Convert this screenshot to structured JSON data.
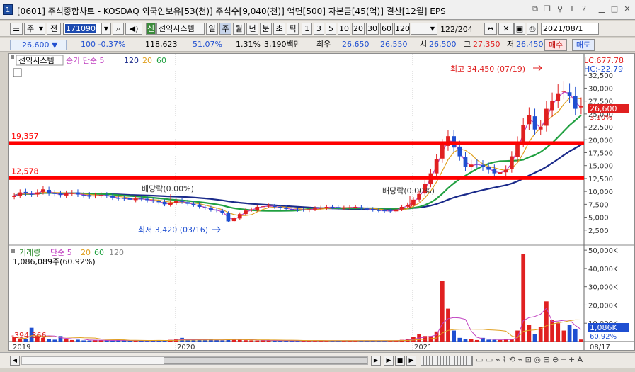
{
  "window": {
    "number": "1",
    "title": "[0601] 주식종합차트 - KOSDAQ 외국인보유[53(천)] 주식수[9,040(천)] 액면[500] 자본금[45(억)] 결산[12월] EPS"
  },
  "toolbar": {
    "period_select": "주",
    "prev_label": "전",
    "stock_code": "171090",
    "indicator_label": "선익시스템",
    "new_badge": "신",
    "periods": [
      "일",
      "주",
      "월",
      "년",
      "분",
      "초",
      "틱"
    ],
    "selected_period": "주",
    "intervals": [
      "1",
      "3",
      "5",
      "10",
      "20",
      "30",
      "60",
      "120"
    ],
    "count_display": "122",
    "count_total": "204",
    "date_value": "2021/08/1"
  },
  "quote": {
    "price": "26,600",
    "change": "100",
    "change_pct": "-0.37%",
    "volume": "118,623",
    "ratio": "51.07%",
    "rate2": "1.31%",
    "amount": "3,190백만",
    "bid_label": "최우",
    "best_ask": "26,650",
    "best_bid": "26,550",
    "open_label": "시",
    "open": "26,500",
    "high_label": "고",
    "high": "27,350",
    "low_label": "저",
    "low": "26,450",
    "buy_label": "매수",
    "sell_label": "매도"
  },
  "price_panel": {
    "stock_tag": "선익시스템",
    "ma_legend": {
      "prefix": "종가 단순",
      "p5": "5",
      "p120": "120",
      "p20": "20",
      "p60": "60"
    },
    "lc": "LC:677.78",
    "hc": "HC:-22.79",
    "current_price_tag": "26,600",
    "current_pct_tag": "3.10%",
    "max_label": "최고 34,450 (07/19)",
    "min_label": "최저 3,420 (03/16)",
    "dividend_label_1": "배당락(0.00%)",
    "dividend_label_2": "배당락(0.00%)",
    "hline_1_label": "19,357",
    "hline_2_label": "12,578",
    "y_ticks": [
      "32,500",
      "30,000",
      "27,500",
      "25,000",
      "22,500",
      "20,000",
      "17,500",
      "15,000",
      "12,500",
      "10,000",
      "7,500",
      "5,000",
      "2,500"
    ]
  },
  "volume_panel": {
    "legend": {
      "label": "거래량",
      "prefix": "단순",
      "p5": "5",
      "p20": "20",
      "p60": "60",
      "p120": "120"
    },
    "current_volume_text": "1,086,089주(60.92%)",
    "neg_label": "-394,366",
    "volume_tag": "1,086K",
    "pct_tag": "60.92%",
    "y_ticks": [
      "50,000K",
      "40,000K",
      "30,000K",
      "20,000K",
      "10,000K"
    ]
  },
  "x_axis": {
    "labels": [
      "2019",
      "2020",
      "2021"
    ],
    "right_date": "08/17"
  },
  "colors": {
    "up": "#e02020",
    "down": "#1f4fd1",
    "ma5": "#c040c0",
    "ma20": "#e0a020",
    "ma60": "#20a040",
    "ma120": "#1a2a8a",
    "hline": "#ff0000"
  },
  "chart_data": {
    "type": "candlestick",
    "price_range": [
      0,
      35000
    ],
    "volume_range_k": [
      0,
      52000
    ],
    "horizontal_lines": [
      19357,
      12578
    ],
    "weekly_close": [
      9200,
      9800,
      9600,
      9400,
      9800,
      10400,
      9700,
      9500,
      9300,
      9600,
      9700,
      9400,
      9300,
      9000,
      9200,
      9300,
      9100,
      8800,
      8700,
      8600,
      8400,
      8600,
      8500,
      8300,
      8200,
      7900,
      7500,
      7700,
      8100,
      8000,
      7600,
      7400,
      7000,
      6800,
      6400,
      6300,
      5800,
      4200,
      4800,
      5600,
      6300,
      6500,
      7000,
      7100,
      7200,
      7000,
      6800,
      6600,
      6500,
      6400,
      6400,
      6500,
      6700,
      6800,
      7000,
      6900,
      6800,
      6800,
      6900,
      7000,
      6700,
      6500,
      6400,
      6300,
      6200,
      6200,
      6500,
      7000,
      7400,
      8400,
      9500,
      11500,
      13500,
      16200,
      19000,
      20700,
      18500,
      16800,
      14700,
      15200,
      15300,
      14700,
      14200,
      13500,
      13700,
      14200,
      16800,
      19500,
      22800,
      24800,
      22000,
      22500,
      26000,
      27500,
      29000,
      29500,
      28500,
      26000,
      26600
    ],
    "weekly_volume_k": [
      2500,
      1200,
      1500,
      7500,
      3000,
      2000,
      1500,
      1000,
      3000,
      1200,
      800,
      1000,
      600,
      500,
      800,
      700,
      600,
      500,
      800,
      600,
      500,
      400,
      600,
      500,
      700,
      600,
      500,
      900,
      1200,
      2000,
      800,
      600,
      900,
      700,
      1200,
      800,
      600,
      1500,
      1300,
      1000,
      700,
      600,
      500,
      700,
      600,
      500,
      400,
      500,
      400,
      500,
      600,
      500,
      600,
      500,
      400,
      500,
      400,
      500,
      600,
      500,
      400,
      500,
      600,
      500,
      400,
      500,
      600,
      900,
      1500,
      2500,
      4000,
      3000,
      3000,
      5500,
      33000,
      18000,
      6000,
      2000,
      1500,
      1200,
      800,
      2000,
      1000,
      900,
      800,
      1000,
      1500,
      6000,
      48000,
      9000,
      4000,
      8000,
      22000,
      12000,
      10000,
      6000,
      9000,
      7000,
      1086
    ]
  }
}
